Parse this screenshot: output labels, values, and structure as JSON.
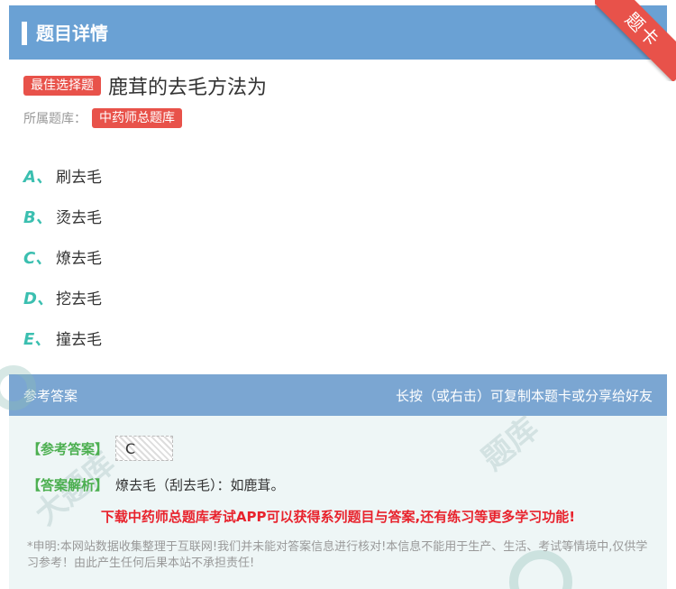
{
  "header": {
    "title": "题目详情",
    "ribbon": "题卡"
  },
  "question": {
    "type_badge": "最佳选择题",
    "text": "鹿茸的去毛方法为",
    "bank_label": "所属题库：",
    "bank_name": "中药师总题库"
  },
  "options": [
    {
      "letter": "A、",
      "text": "刷去毛"
    },
    {
      "letter": "B、",
      "text": "烫去毛"
    },
    {
      "letter": "C、",
      "text": "燎去毛"
    },
    {
      "letter": "D、",
      "text": "挖去毛"
    },
    {
      "letter": "E、",
      "text": "撞去毛"
    }
  ],
  "answer": {
    "head_left": "参考答案",
    "head_right": "长按（或右击）可复制本题卡或分享给好友",
    "answer_label": "【参考答案】",
    "answer_value": "C",
    "analysis_label": "【答案解析】",
    "analysis_text": "燎去毛（刮去毛）：如鹿茸。",
    "promo": "下载中药师总题库考试APP可以获得系列题目与答案,还有练习等更多学习功能!",
    "disclaimer": "*申明:本网站数据收集整理于互联网!我们并未能对答案信息进行核对!本信息不能用于生产、生活、考试等情境中,仅供学习参考！由此产生任何后果本站不承担责任!"
  },
  "colors": {
    "header": "#6aa1d4",
    "badge": "#e8524a",
    "option_letter": "#3bbfb0",
    "promo": "#e8232d"
  }
}
